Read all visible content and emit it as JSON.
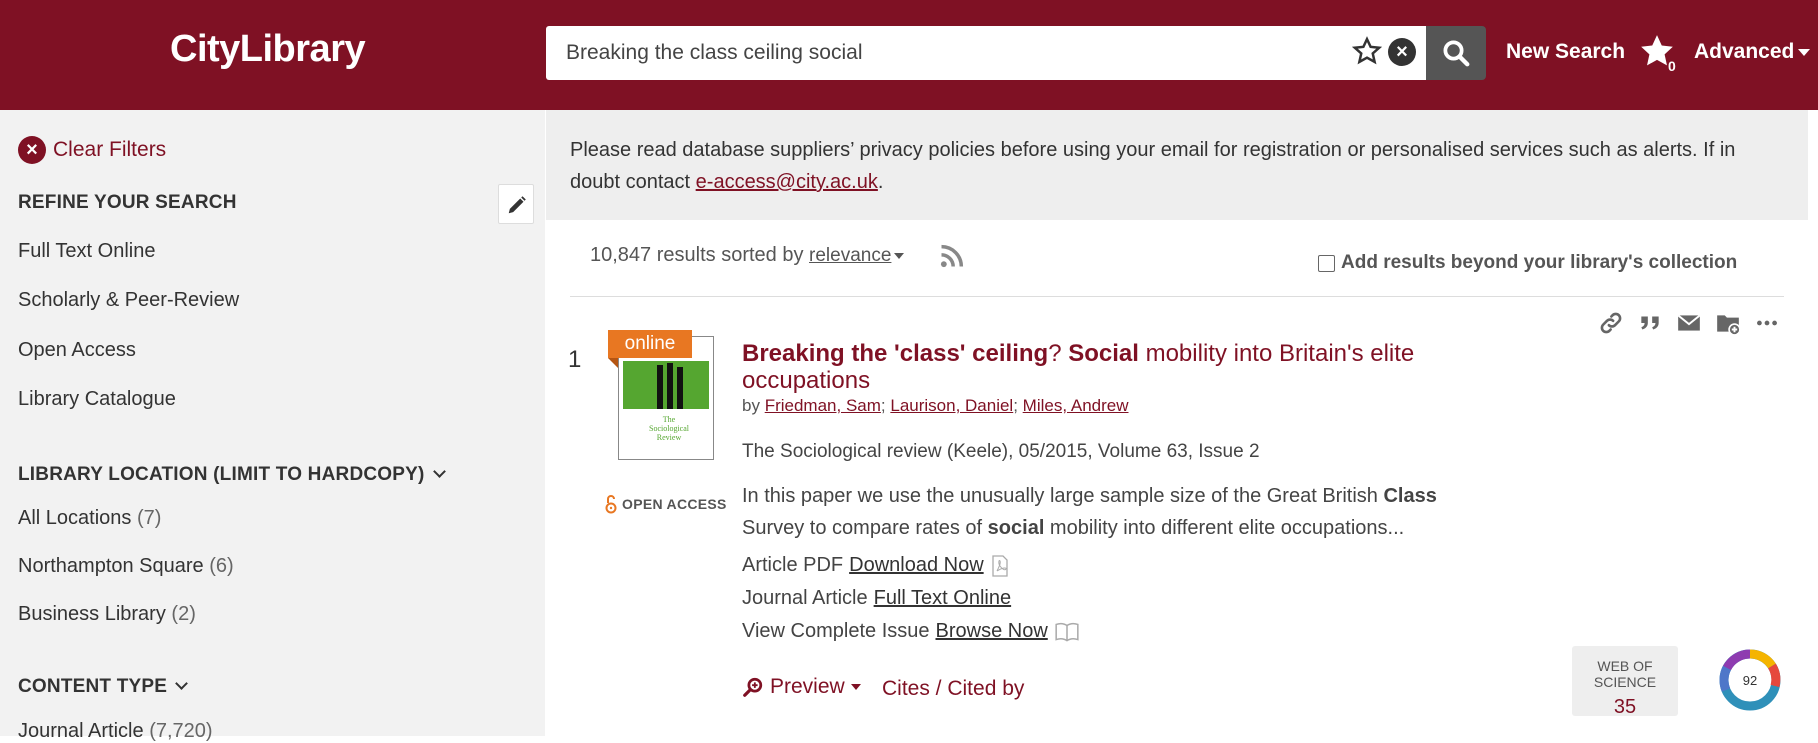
{
  "header": {
    "logo": "CityLibrary",
    "search_value": "Breaking the class ceiling social",
    "new_search": "New Search",
    "saved_count": "0",
    "advanced": "Advanced"
  },
  "sidebar": {
    "clear_filters": "Clear Filters",
    "refine_heading": "REFINE YOUR SEARCH",
    "refine_items": [
      "Full Text Online",
      "Scholarly & Peer-Review",
      "Open Access",
      "Library Catalogue"
    ],
    "location_heading": "LIBRARY LOCATION (LIMIT TO HARDCOPY)",
    "locations": [
      {
        "label": "All Locations",
        "count": "(7)"
      },
      {
        "label": "Northampton Square",
        "count": "(6)"
      },
      {
        "label": "Business Library",
        "count": "(2)"
      }
    ],
    "content_heading": "CONTENT TYPE",
    "content_items": [
      {
        "label": "Journal Article",
        "count": "(7,720)"
      }
    ]
  },
  "notice": {
    "text": "Please read database suppliers’ privacy policies before using your email for registration or personalised services such as alerts. If in doubt contact ",
    "email": "e-access@city.ac.uk",
    "end": "."
  },
  "results": {
    "count_text": "10,847 results sorted by",
    "sort": "relevance",
    "beyond_label": "Add results beyond your library's collection"
  },
  "result": {
    "number": "1",
    "online_tag": "online",
    "cover_title": "The Sociological Review",
    "open_access": "OPEN ACCESS",
    "title_b1": "Breaking the 'class' ceiling",
    "title_q": "? ",
    "title_b2": "Social",
    "title_rest": " mobility into Britain's elite occupations",
    "by": "by",
    "authors": [
      "Friedman, Sam",
      "Laurison, Daniel",
      "Miles, Andrew"
    ],
    "publication": "The Sociological review (Keele), 05/2015, Volume 63, Issue 2",
    "abstract_1": "In this paper we use the unusually large sample size of the Great British ",
    "abstract_b1": "Class",
    "abstract_2": "Survey to compare rates of ",
    "abstract_b2": "social",
    "abstract_3": " mobility into different elite occupations...",
    "links": [
      {
        "prefix": "Article PDF",
        "link": "Download Now"
      },
      {
        "prefix": "Journal Article",
        "link": "Full Text Online"
      },
      {
        "prefix": "View Complete Issue",
        "link": "Browse Now"
      }
    ],
    "preview": "Preview",
    "cites": "Cites / Cited by",
    "wos_label": "WEB OF SCIENCE",
    "wos_value": "35",
    "altmetric": "92"
  },
  "colors": {
    "brand": "#7f1124",
    "online_tag": "#e87722",
    "open_access": "#e87722"
  }
}
